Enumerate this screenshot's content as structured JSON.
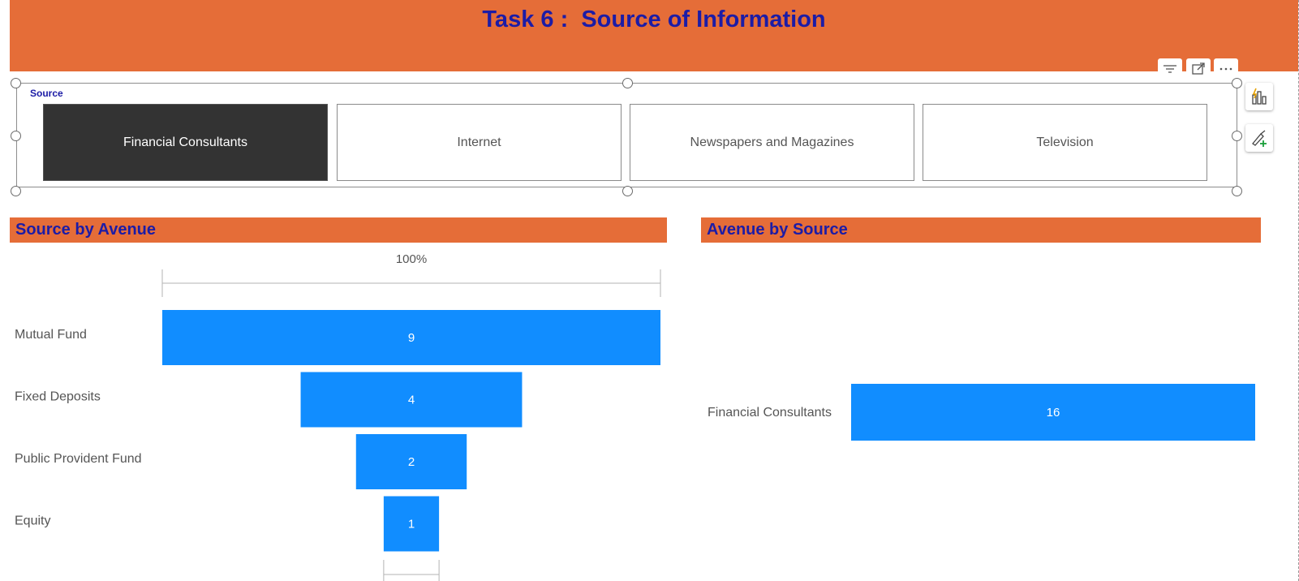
{
  "page": {
    "title": "Task 6 :  Source of Information"
  },
  "visual_header": {
    "icons": [
      "filter-icon",
      "focus-mode-icon",
      "more-options-icon"
    ]
  },
  "side_pane": {
    "icons": [
      "format-visual-icon",
      "analytics-icon"
    ]
  },
  "slicer": {
    "label": "Source",
    "options": [
      {
        "label": "Financial Consultants",
        "selected": true
      },
      {
        "label": "Internet",
        "selected": false
      },
      {
        "label": "Newspapers and Magazines",
        "selected": false
      },
      {
        "label": "Television",
        "selected": false
      }
    ]
  },
  "colors": {
    "banner": "#e56d38",
    "title_text": "#1c1ca6",
    "bar": "#118dff",
    "selected_tile": "#333333"
  },
  "charts": {
    "left_title": "Source by Avenue",
    "right_title": "Avenue by Source"
  },
  "chart_data": [
    {
      "type": "funnel",
      "title": "Source by Avenue",
      "top_label": "100%",
      "categories": [
        "Mutual Fund",
        "Fixed Deposits",
        "Public Provident Fund",
        "Equity"
      ],
      "values": [
        9,
        4,
        2,
        1
      ]
    },
    {
      "type": "bar",
      "orientation": "horizontal",
      "title": "Avenue by Source",
      "categories": [
        "Financial Consultants"
      ],
      "values": [
        16
      ]
    }
  ]
}
